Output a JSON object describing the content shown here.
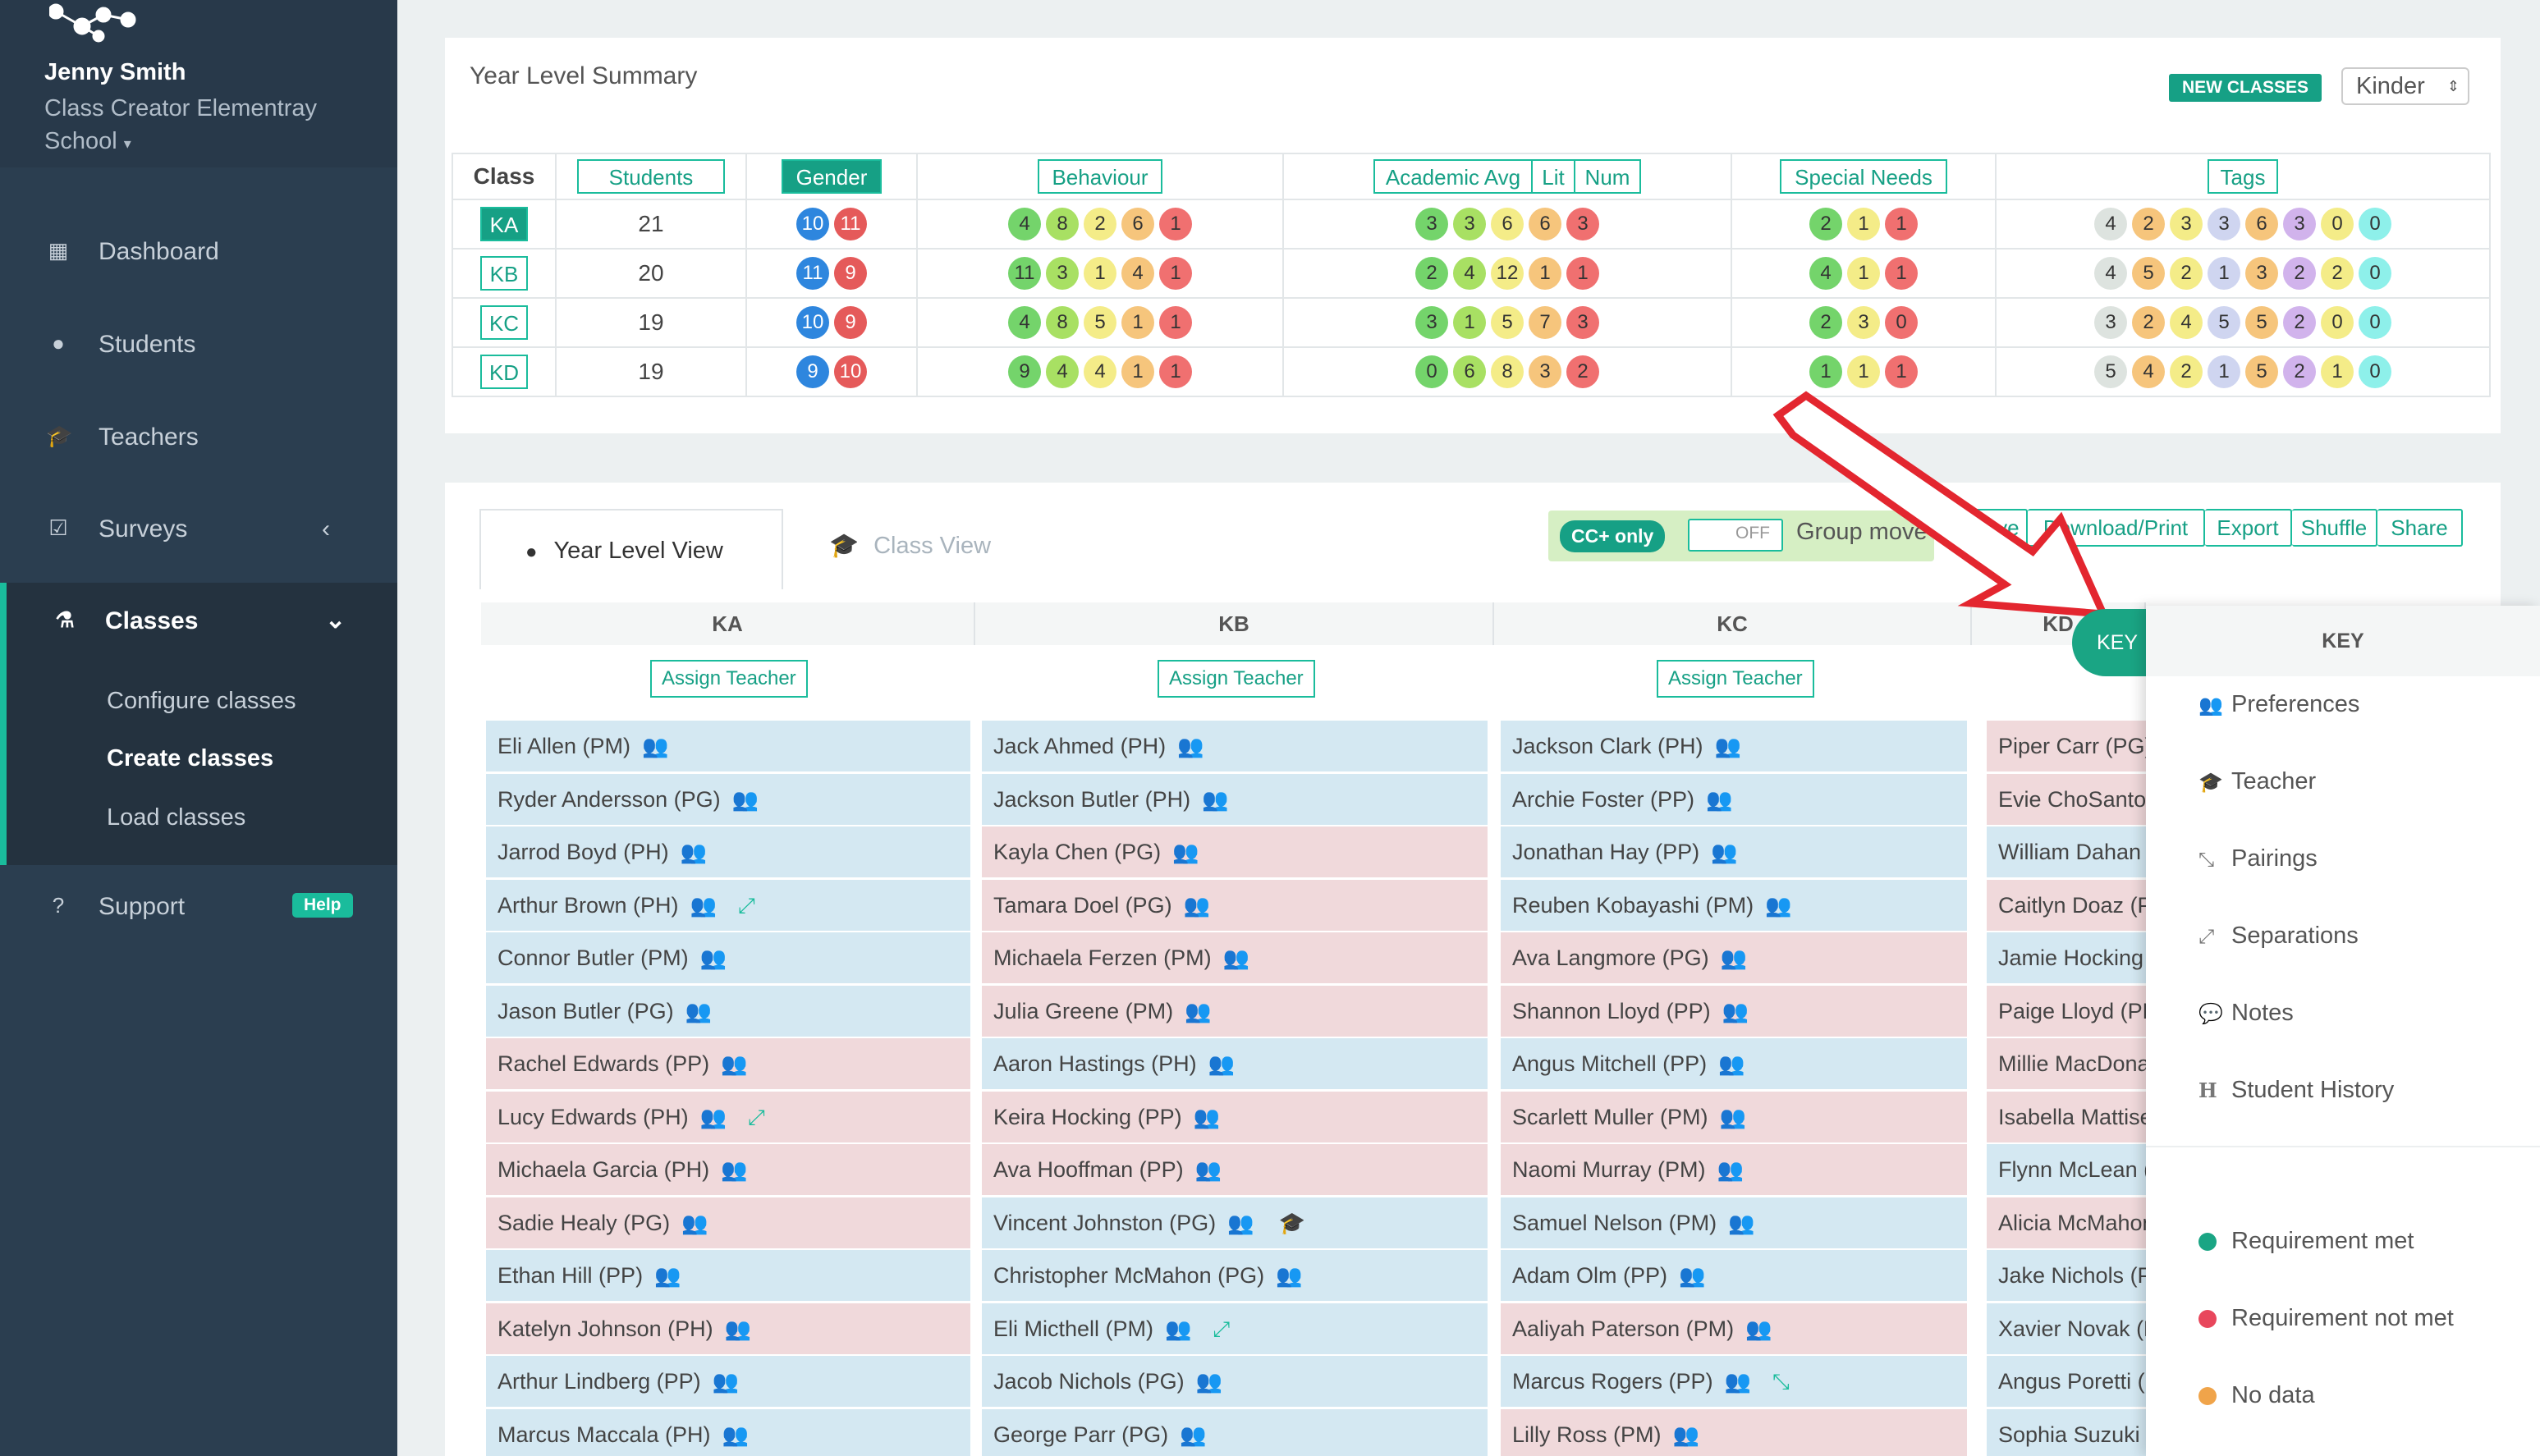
{
  "sidebar": {
    "user_name": "Jenny Smith",
    "school": "Class Creator Elementray School",
    "nav": [
      {
        "label": "Dashboard",
        "icon": "dashboard-icon"
      },
      {
        "label": "Students",
        "icon": "user-icon"
      },
      {
        "label": "Teachers",
        "icon": "graduation-cap-icon"
      },
      {
        "label": "Surveys",
        "icon": "checkbox-icon"
      },
      {
        "label": "Classes",
        "icon": "flask-icon"
      },
      {
        "label": "Support",
        "icon": "question-icon"
      }
    ],
    "classes_sub": [
      "Configure classes",
      "Create classes",
      "Load classes"
    ],
    "help_badge": "Help"
  },
  "summary": {
    "title": "Year Level Summary",
    "new_classes_label": "NEW CLASSES",
    "year_select": "Kinder",
    "headers": {
      "class": "Class",
      "students": "Students",
      "gender": "Gender",
      "behaviour": "Behaviour",
      "academic_avg": "Academic Avg",
      "lit": "Lit",
      "num": "Num",
      "special_needs": "Special Needs",
      "tags": "Tags"
    },
    "rows": [
      {
        "class": "KA",
        "students": "21",
        "gender": [
          "10",
          "11"
        ],
        "behaviour": [
          "4",
          "8",
          "2",
          "6",
          "1"
        ],
        "academic": [
          "3",
          "3",
          "6",
          "6",
          "3"
        ],
        "special": [
          "2",
          "1",
          "1"
        ],
        "tags": [
          "4",
          "2",
          "3",
          "3",
          "6",
          "3",
          "0",
          "0"
        ]
      },
      {
        "class": "KB",
        "students": "20",
        "gender": [
          "11",
          "9"
        ],
        "behaviour": [
          "11",
          "3",
          "1",
          "4",
          "1"
        ],
        "academic": [
          "2",
          "4",
          "12",
          "1",
          "1"
        ],
        "special": [
          "4",
          "1",
          "1"
        ],
        "tags": [
          "4",
          "5",
          "2",
          "1",
          "3",
          "2",
          "2",
          "0"
        ]
      },
      {
        "class": "KC",
        "students": "19",
        "gender": [
          "10",
          "9"
        ],
        "behaviour": [
          "4",
          "8",
          "5",
          "1",
          "1"
        ],
        "academic": [
          "3",
          "1",
          "5",
          "7",
          "3"
        ],
        "special": [
          "2",
          "3",
          "0"
        ],
        "tags": [
          "3",
          "2",
          "4",
          "5",
          "5",
          "2",
          "0",
          "0"
        ]
      },
      {
        "class": "KD",
        "students": "19",
        "gender": [
          "9",
          "10"
        ],
        "behaviour": [
          "9",
          "4",
          "4",
          "1",
          "1"
        ],
        "academic": [
          "0",
          "6",
          "8",
          "3",
          "2"
        ],
        "special": [
          "1",
          "1",
          "1"
        ],
        "tags": [
          "5",
          "4",
          "2",
          "1",
          "5",
          "2",
          "1",
          "0"
        ]
      }
    ]
  },
  "view": {
    "tab_year": "Year Level View",
    "tab_class": "Class View",
    "cc_only": "CC+ only",
    "toggle": "OFF",
    "group_move": "Group move",
    "actions": [
      "Save",
      "Download/Print",
      "Export",
      "Shuffle",
      "Share"
    ],
    "assign_teacher": "Assign Teacher",
    "key_button": "KEY"
  },
  "columns": [
    {
      "name": "KA",
      "students": [
        {
          "name": "Eli Allen (PM)",
          "row": "bl"
        },
        {
          "name": "Ryder Andersson (PG)",
          "row": "bl"
        },
        {
          "name": "Jarrod Boyd (PH)",
          "row": "bl"
        },
        {
          "name": "Arthur Brown (PH)",
          "row": "bl",
          "extra": "sep"
        },
        {
          "name": "Connor Butler (PM)",
          "row": "bl"
        },
        {
          "name": "Jason Butler (PG)",
          "row": "bl"
        },
        {
          "name": "Rachel Edwards (PP)",
          "row": "pk"
        },
        {
          "name": "Lucy Edwards (PH)",
          "row": "pk",
          "extra": "sep"
        },
        {
          "name": "Michaela Garcia (PH)",
          "row": "pk"
        },
        {
          "name": "Sadie Healy (PG)",
          "row": "pk"
        },
        {
          "name": "Ethan Hill (PP)",
          "row": "bl"
        },
        {
          "name": "Katelyn Johnson (PH)",
          "row": "pk"
        },
        {
          "name": "Arthur Lindberg (PP)",
          "row": "bl"
        },
        {
          "name": "Marcus Maccala (PH)",
          "row": "bl"
        }
      ]
    },
    {
      "name": "KB",
      "students": [
        {
          "name": "Jack Ahmed (PH)",
          "row": "bl"
        },
        {
          "name": "Jackson Butler (PH)",
          "row": "bl"
        },
        {
          "name": "Kayla Chen (PG)",
          "row": "pk"
        },
        {
          "name": "Tamara Doel (PG)",
          "row": "pk"
        },
        {
          "name": "Michaela Ferzen (PM)",
          "row": "pk"
        },
        {
          "name": "Julia Greene (PM)",
          "row": "pk"
        },
        {
          "name": "Aaron Hastings (PH)",
          "row": "bl"
        },
        {
          "name": "Keira Hocking (PP)",
          "row": "pk"
        },
        {
          "name": "Ava Hooffman (PP)",
          "row": "pk"
        },
        {
          "name": "Vincent Johnston (PG)",
          "row": "bl",
          "extra": "teacher"
        },
        {
          "name": "Christopher McMahon (PG)",
          "row": "bl"
        },
        {
          "name": "Eli Micthell (PM)",
          "row": "bl",
          "extra": "sep"
        },
        {
          "name": "Jacob Nichols (PG)",
          "row": "bl"
        },
        {
          "name": "George Parr (PG)",
          "row": "bl"
        }
      ]
    },
    {
      "name": "KC",
      "students": [
        {
          "name": "Jackson Clark (PH)",
          "row": "bl"
        },
        {
          "name": "Archie Foster (PP)",
          "row": "bl"
        },
        {
          "name": "Jonathan Hay (PP)",
          "row": "bl"
        },
        {
          "name": "Reuben Kobayashi (PM)",
          "row": "bl"
        },
        {
          "name": "Ava Langmore (PG)",
          "row": "pk"
        },
        {
          "name": "Shannon Lloyd (PP)",
          "row": "pk"
        },
        {
          "name": "Angus Mitchell (PP)",
          "row": "bl"
        },
        {
          "name": "Scarlett Muller (PM)",
          "row": "pk"
        },
        {
          "name": "Naomi Murray (PM)",
          "row": "pk"
        },
        {
          "name": "Samuel Nelson (PM)",
          "row": "bl"
        },
        {
          "name": "Adam Olm (PP)",
          "row": "bl"
        },
        {
          "name": "Aaliyah Paterson (PM)",
          "row": "pk"
        },
        {
          "name": "Marcus Rogers (PP)",
          "row": "bl",
          "extra": "pair"
        },
        {
          "name": "Lilly Ross (PM)",
          "row": "pk"
        }
      ]
    },
    {
      "name": "KD",
      "students": [
        {
          "name": "Piper Carr (PG)",
          "row": "pk"
        },
        {
          "name": "Evie ChoSantos",
          "row": "pk"
        },
        {
          "name": "William Dahan (",
          "row": "bl"
        },
        {
          "name": "Caitlyn Doaz (PH",
          "row": "pk"
        },
        {
          "name": "Jamie Hocking (F",
          "row": "bl"
        },
        {
          "name": "Paige Lloyd (PH)",
          "row": "pk"
        },
        {
          "name": "Millie MacDonal",
          "row": "pk"
        },
        {
          "name": "Isabella Mattise",
          "row": "pk"
        },
        {
          "name": "Flynn McLean (P",
          "row": "bl"
        },
        {
          "name": "Alicia McMahon",
          "row": "pk"
        },
        {
          "name": "Jake Nichols (PH",
          "row": "bl"
        },
        {
          "name": "Xavier Novak (PI",
          "row": "bl"
        },
        {
          "name": "Angus Poretti (P",
          "row": "bl"
        },
        {
          "name": "Sophia Suzuki (P",
          "row": "bl"
        }
      ]
    }
  ],
  "key": {
    "title": "KEY",
    "items": [
      {
        "label": "Preferences",
        "icon": "group-icon"
      },
      {
        "label": "Teacher",
        "icon": "graduation-cap-icon"
      },
      {
        "label": "Pairings",
        "icon": "pairings-icon"
      },
      {
        "label": "Separations",
        "icon": "separations-icon"
      },
      {
        "label": "Notes",
        "icon": "comment-icon"
      },
      {
        "label": "Student History",
        "icon": "history-icon"
      }
    ],
    "status": [
      {
        "label": "Requirement met",
        "color": "#1aa584"
      },
      {
        "label": "Requirement not met",
        "color": "#e8475c"
      },
      {
        "label": "No data",
        "color": "#f0a44a"
      }
    ]
  },
  "colors": {
    "accent": "#1abc9c",
    "sidebar": "#2b3e50",
    "arrow": "#e3262f"
  }
}
